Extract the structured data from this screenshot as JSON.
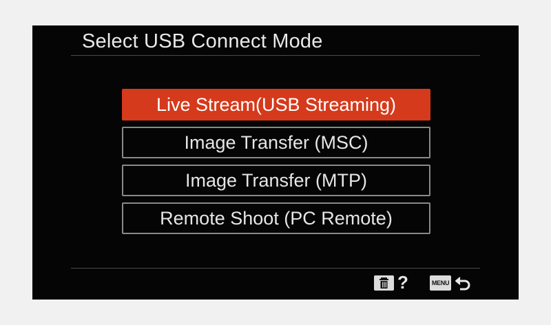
{
  "screen": {
    "title": "Select USB Connect Mode"
  },
  "menu": {
    "items": [
      {
        "label": "Live Stream(USB Streaming)",
        "selected": true
      },
      {
        "label": "Image Transfer (MSC)",
        "selected": false
      },
      {
        "label": "Image Transfer (MTP)",
        "selected": false
      },
      {
        "label": "Remote Shoot (PC Remote)",
        "selected": false
      }
    ]
  },
  "footer": {
    "help_glyph": "?",
    "menu_label": "MENU",
    "delete_icon": "trash-icon",
    "back_icon": "return-arrow-icon"
  },
  "colors": {
    "background": "#050505",
    "selected_item": "#d53a1c",
    "item_border": "#8a8a8a",
    "text": "#e6e6e6"
  }
}
